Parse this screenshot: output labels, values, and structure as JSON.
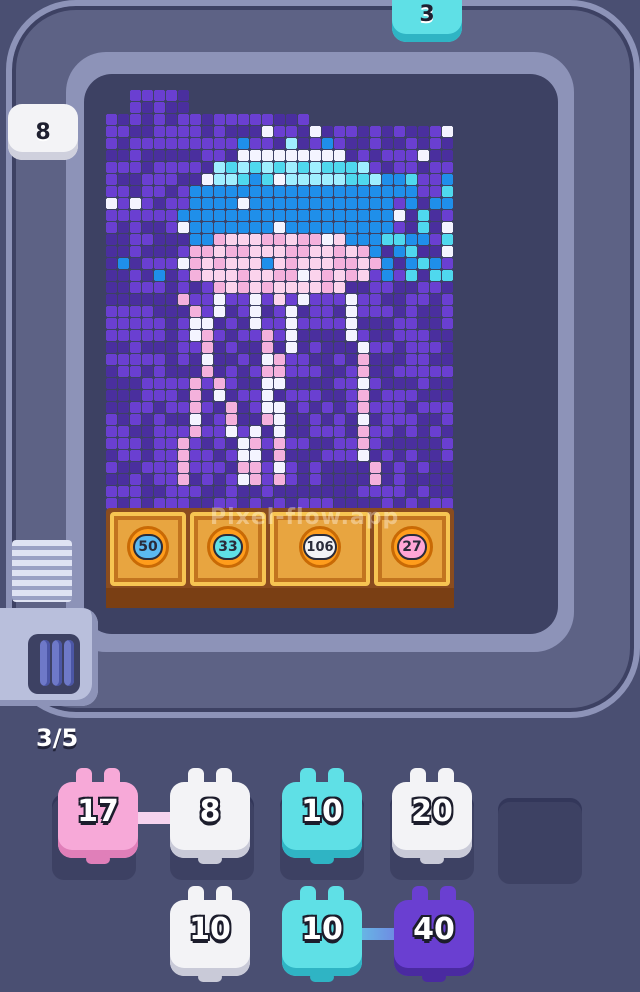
{
  "watermark": "Pixel-flow.app",
  "progress": {
    "text": "3/5",
    "current": 3,
    "total": 5
  },
  "track_shooters": [
    {
      "id": "top",
      "value": "3",
      "color": "#5fe0e6"
    },
    {
      "id": "left",
      "value": "8",
      "color": "#f3f3f6"
    }
  ],
  "crates": [
    {
      "value": "50",
      "color": "#5bb9f0"
    },
    {
      "value": "33",
      "color": "#5fe0e6"
    },
    {
      "value": "106",
      "color": "#f3f3f6"
    },
    {
      "value": "27",
      "color": "#ffa6d6"
    }
  ],
  "queue": {
    "row1": [
      {
        "value": "17",
        "color": "pink"
      },
      {
        "value": "8",
        "color": "white"
      },
      {
        "value": "10",
        "color": "cyan"
      },
      {
        "value": "20",
        "color": "white"
      },
      {
        "value": "",
        "color": "empty"
      }
    ],
    "row2": [
      {
        "value": "10",
        "color": "white"
      },
      {
        "value": "10",
        "color": "cyan"
      },
      {
        "value": "40",
        "color": "purple"
      }
    ]
  },
  "palette": {
    "purple_dark": "#4a2f9e",
    "purple": "#6a3fd1",
    "blue": "#1f8fea",
    "cyan": "#4fd8ee",
    "light_cyan": "#9fefff",
    "white": "#f4f4ff",
    "pink": "#f4b1dc",
    "pink_light": "#fbd3ec",
    "lavender": "#b5a6f2"
  }
}
